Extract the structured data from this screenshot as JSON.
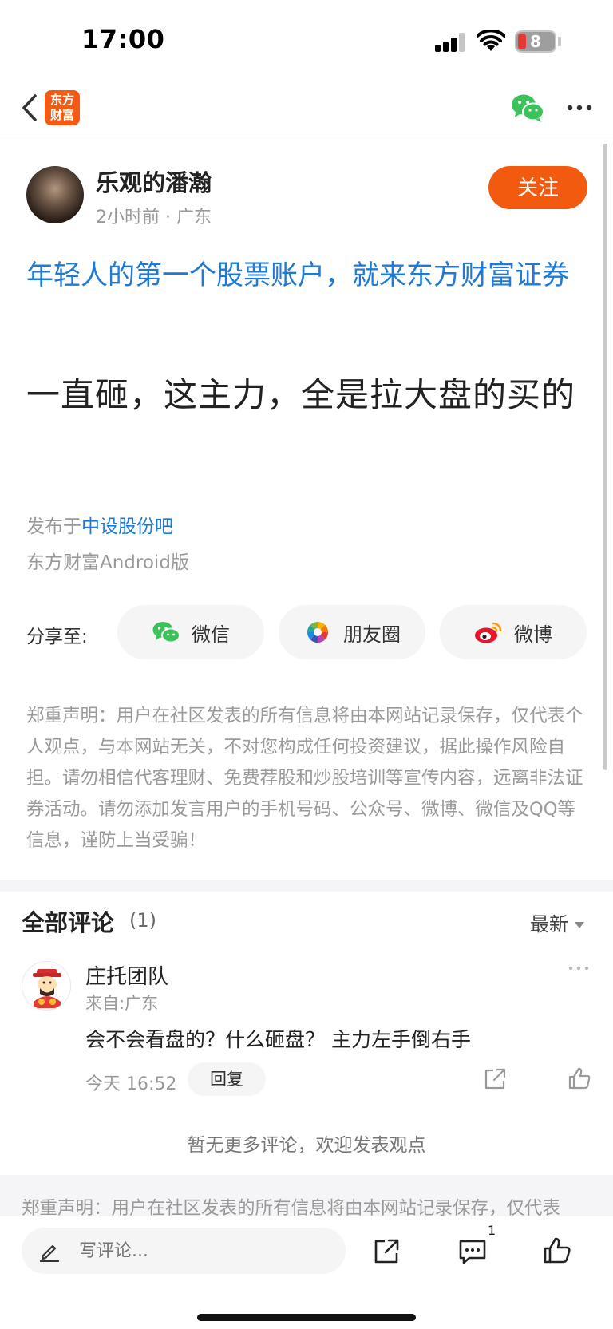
{
  "status_bar": {
    "time": "17:00",
    "battery": "8"
  },
  "nav": {
    "logo_text_line1": "东方",
    "logo_text_line2": "财富",
    "icons": [
      "back-icon",
      "wechat-icon",
      "more-icon"
    ]
  },
  "post": {
    "author": "乐观的潘瀚",
    "meta": "2小时前 · 广东",
    "follow_label": "关注",
    "ad_text": "年轻人的第一个股票账户，就来东方财富证券",
    "title": "一直砸，这主力，全是拉大盘的买的",
    "published_prefix": "发布于",
    "published_bar": "中设股份吧",
    "client": "东方财富Android版"
  },
  "share": {
    "label": "分享至:",
    "options": [
      {
        "label": "微信",
        "icon": "wechat-icon"
      },
      {
        "label": "朋友圈",
        "icon": "moments-icon"
      },
      {
        "label": "微博",
        "icon": "weibo-icon"
      }
    ]
  },
  "disclaimer": "郑重声明：用户在社区发表的所有信息将由本网站记录保存，仅代表个人观点，与本网站无关，不对您构成任何投资建议，据此操作风险自担。请勿相信代客理财、免费荐股和炒股培训等宣传内容，远离非法证券活动。请勿添加发言用户的手机号码、公众号、微博、微信及QQ等信息，谨防上当受骗！",
  "comments": {
    "title": "全部评论",
    "count": "(1)",
    "sort": "最新",
    "items": [
      {
        "name": "庄托团队",
        "from": "来自:广东",
        "text": "会不会看盘的？什么砸盘？ 主力左手倒右手",
        "time": "今天 16:52",
        "reply_label": "回复"
      }
    ],
    "no_more": "暂无更多评论，欢迎发表观点"
  },
  "bottom_disclaimer": "郑重声明：用户在社区发表的所有信息将由本网站记录保存，仅代表",
  "bottom_bar": {
    "placeholder": "写评论...",
    "comment_badge": "1"
  },
  "colors": {
    "brand": "#f25a0f",
    "link": "#1e7ad6",
    "muted": "#999999"
  }
}
